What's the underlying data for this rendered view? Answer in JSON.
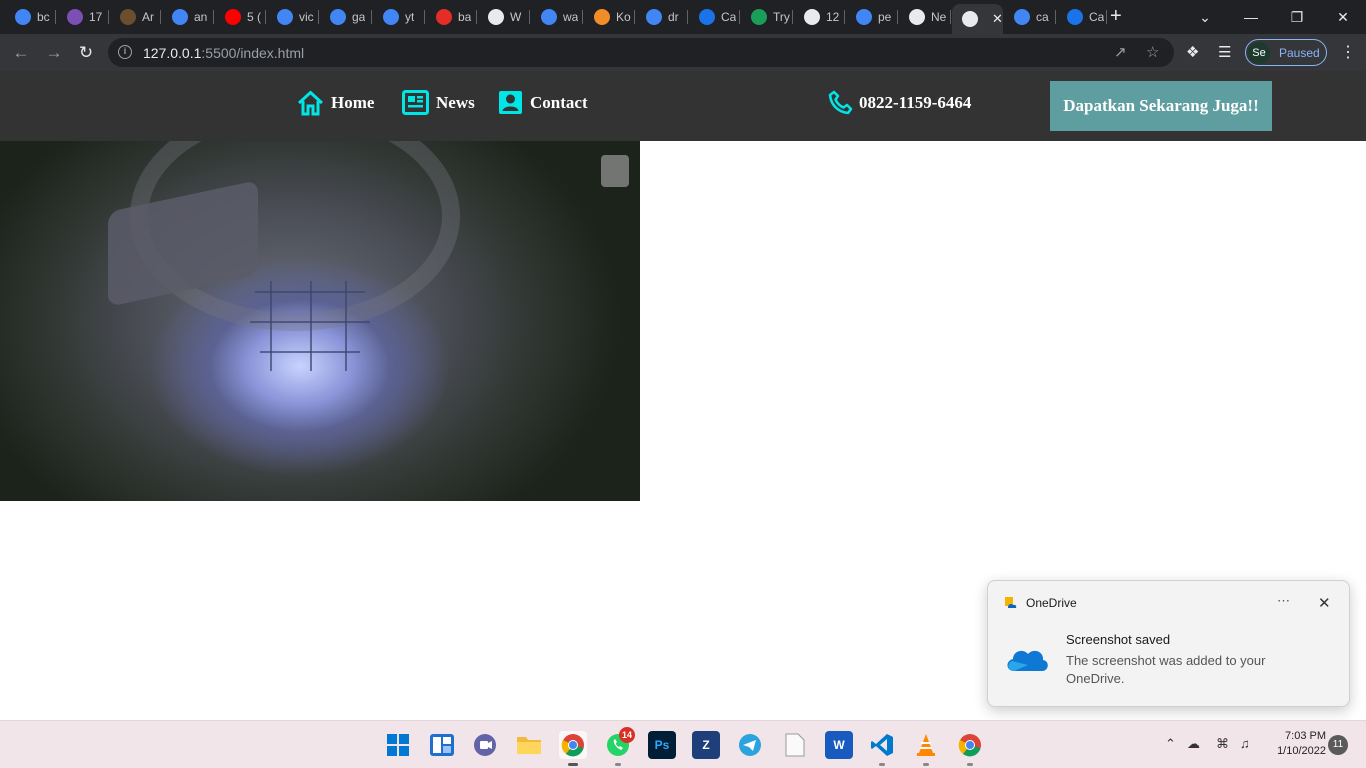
{
  "browser": {
    "tabs": [
      {
        "label": "bc",
        "icon": "google-icon",
        "color": "#4285f4"
      },
      {
        "label": "17",
        "icon": "coloring-icon",
        "color": "#7b4fb3"
      },
      {
        "label": "Ar",
        "icon": "book-icon",
        "color": "#6b4e2e"
      },
      {
        "label": "an",
        "icon": "google-icon",
        "color": "#4285f4"
      },
      {
        "label": "5 (",
        "icon": "youtube-icon",
        "color": "#ff0000"
      },
      {
        "label": "vic",
        "icon": "google-icon",
        "color": "#4285f4"
      },
      {
        "label": "ga",
        "icon": "google-icon",
        "color": "#4285f4"
      },
      {
        "label": "yt",
        "icon": "google-icon",
        "color": "#4285f4"
      },
      {
        "label": "ba",
        "icon": "capcut-icon",
        "color": "#e52d27"
      },
      {
        "label": "W",
        "icon": "globe-icon",
        "color": "#e8eaed"
      },
      {
        "label": "wa",
        "icon": "google-icon",
        "color": "#4285f4"
      },
      {
        "label": "Ko",
        "icon": "jh-icon",
        "color": "#f28c28"
      },
      {
        "label": "dr",
        "icon": "google-icon",
        "color": "#4285f4"
      },
      {
        "label": "Ca",
        "icon": "chart-icon",
        "color": "#1a73e8"
      },
      {
        "label": "Try",
        "icon": "w-icon",
        "color": "#1a9f5a"
      },
      {
        "label": "12",
        "icon": "globe-icon",
        "color": "#e8eaed"
      },
      {
        "label": "pe",
        "icon": "google-icon",
        "color": "#4285f4"
      },
      {
        "label": "Ne",
        "icon": "chrome-icon",
        "color": "#e8eaed"
      },
      {
        "label": "",
        "icon": "globe-icon",
        "color": "#e8eaed",
        "active": true
      },
      {
        "label": "ca",
        "icon": "google-icon",
        "color": "#4285f4"
      },
      {
        "label": "Ca",
        "icon": "c-icon",
        "color": "#1a73e8"
      }
    ],
    "url_host": "127.0.0.1",
    "url_path": ":5500/index.html",
    "profile_initials": "Se",
    "profile_status": "Paused"
  },
  "site": {
    "nav": [
      {
        "label": "Home",
        "icon": "home-icon"
      },
      {
        "label": "News",
        "icon": "newspaper-icon"
      },
      {
        "label": "Contact",
        "icon": "contact-card-icon"
      }
    ],
    "phone": "0822-1159-6464",
    "cta_label": "Dapatkan Sekarang Juga!!",
    "accent_color": "#00e5e5",
    "header_bg": "#333333",
    "cta_bg": "#5f9ea0"
  },
  "toast": {
    "app": "OneDrive",
    "title": "Screenshot saved",
    "body": "The screenshot was added to your OneDrive."
  },
  "taskbar": {
    "whatsapp_badge": "14",
    "time": "7:03 PM",
    "date": "1/10/2022",
    "notifications": "11"
  }
}
